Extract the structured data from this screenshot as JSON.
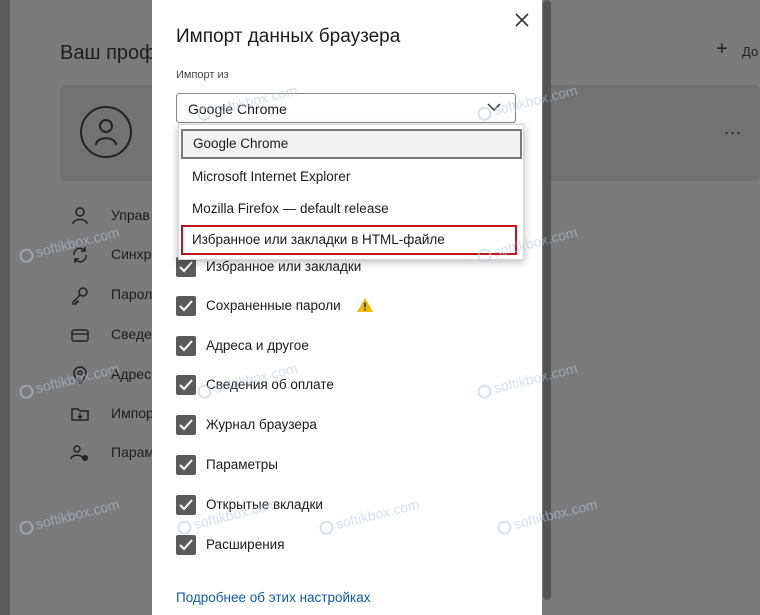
{
  "background": {
    "profile_title": "Ваш проф",
    "add_label": "До",
    "more_label": "...",
    "nav": [
      {
        "label": "Управ",
        "icon": "person-icon"
      },
      {
        "label": "Синхр",
        "icon": "sync-icon"
      },
      {
        "label": "Парол",
        "icon": "key-icon"
      },
      {
        "label": "Сведе",
        "icon": "card-icon"
      },
      {
        "label": "Адрес",
        "icon": "location-icon"
      },
      {
        "label": "Импор",
        "icon": "import-icon"
      },
      {
        "label": "Парам",
        "icon": "settings-people-icon"
      }
    ]
  },
  "dialog": {
    "title": "Импорт данных браузера",
    "import_from_label": "Импорт из",
    "selected_source": "Google Chrome",
    "options": [
      "Google Chrome",
      "Microsoft Internet Explorer",
      "Mozilla Firefox — default release",
      "Избранное или закладки в HTML-файле"
    ],
    "checkboxes": [
      {
        "label": "Избранное или закладки",
        "checked": true
      },
      {
        "label": "Сохраненные пароли",
        "checked": true,
        "warning": true
      },
      {
        "label": "Адреса и другое",
        "checked": true
      },
      {
        "label": "Сведения об оплате",
        "checked": true
      },
      {
        "label": "Журнал браузера",
        "checked": true
      },
      {
        "label": "Параметры",
        "checked": true
      },
      {
        "label": "Открытые вкладки",
        "checked": true
      },
      {
        "label": "Расширения",
        "checked": true
      }
    ],
    "learn_more_link": "Подробнее об этих настройках"
  },
  "watermark": "softikbox.com",
  "colors": {
    "highlight_border": "#c0141f",
    "link": "#0f5bb5",
    "checkbox": "#5b5b5b",
    "warning": "#f2b705"
  }
}
